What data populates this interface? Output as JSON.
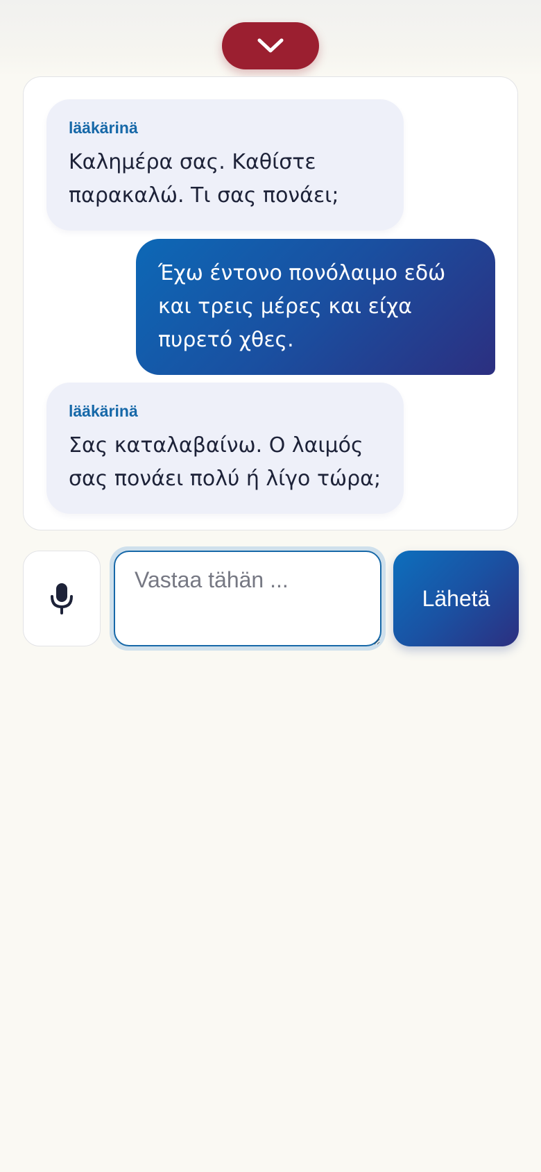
{
  "header": {
    "collapse_icon": "chevron-down-icon",
    "accent_color": "#9b1f30"
  },
  "conversation": {
    "messages": [
      {
        "role": "doctor",
        "speaker": "lääkärinä",
        "text": "Καλημέρα σας. Καθίστε παρακαλώ. Τι σας πονάει;"
      },
      {
        "role": "patient",
        "text": "Έχω έντονο πονόλαιμο εδώ και τρεις μέρες και είχα πυρετό χθες."
      },
      {
        "role": "doctor",
        "speaker": "lääkärinä",
        "text": "Σας καταλαβαίνω. Ο λαιμός σας πονάει πολύ ή λίγο τώρα;"
      }
    ]
  },
  "composer": {
    "mic_icon": "microphone-icon",
    "placeholder": "Vastaa tähän ...",
    "value": "",
    "send_label": "Lähetä",
    "send_color_start": "#0d6fbd",
    "send_color_end": "#2c2f80"
  }
}
